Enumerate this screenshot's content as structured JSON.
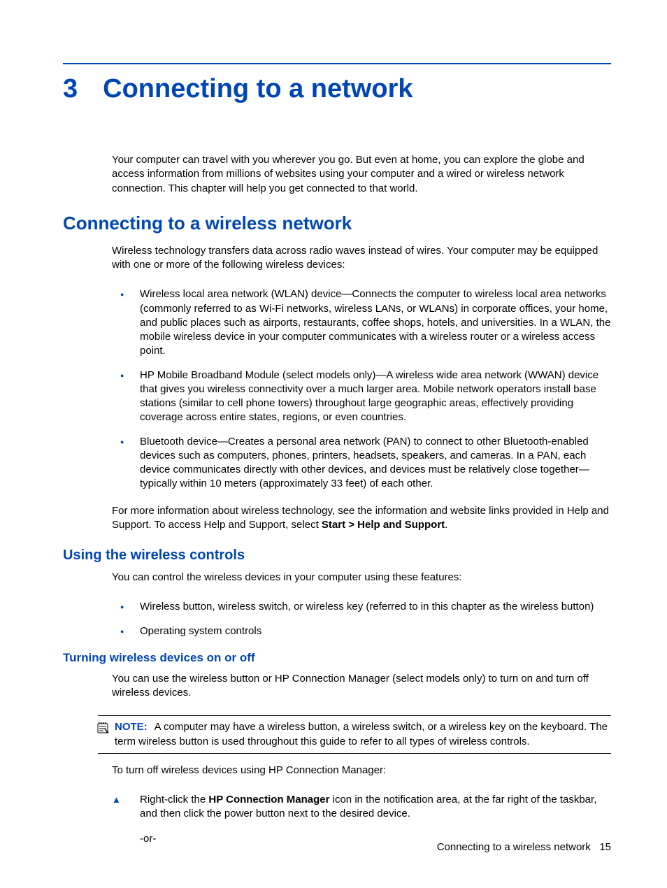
{
  "chapter": {
    "number": "3",
    "title": "Connecting to a network"
  },
  "intro": "Your computer can travel with you wherever you go. But even at home, you can explore the globe and access information from millions of websites using your computer and a wired or wireless network connection. This chapter will help you get connected to that world.",
  "section1": {
    "title": "Connecting to a wireless network",
    "intro": "Wireless technology transfers data across radio waves instead of wires. Your computer may be equipped with one or more of the following wireless devices:",
    "bullets": [
      "Wireless local area network (WLAN) device—Connects the computer to wireless local area networks (commonly referred to as Wi-Fi networks, wireless LANs, or WLANs) in corporate offices, your home, and public places such as airports, restaurants, coffee shops, hotels, and universities. In a WLAN, the mobile wireless device in your computer communicates with a wireless router or a wireless access point.",
      "HP Mobile Broadband Module (select models only)—A wireless wide area network (WWAN) device that gives you wireless connectivity over a much larger area. Mobile network operators install base stations (similar to cell phone towers) throughout large geographic areas, effectively providing coverage across entire states, regions, or even countries.",
      "Bluetooth device—Creates a personal area network (PAN) to connect to other Bluetooth-enabled devices such as computers, phones, printers, headsets, speakers, and cameras. In a PAN, each device communicates directly with other devices, and devices must be relatively close together—typically within 10 meters (approximately 33 feet) of each other."
    ],
    "after_pre": "For more information about wireless technology, see the information and website links provided in Help and Support. To access Help and Support, select ",
    "after_bold": "Start > Help and Support",
    "after_post": "."
  },
  "section2": {
    "title": "Using the wireless controls",
    "intro": "You can control the wireless devices in your computer using these features:",
    "bullets": [
      "Wireless button, wireless switch, or wireless key (referred to in this chapter as the wireless button)",
      "Operating system controls"
    ]
  },
  "section3": {
    "title": "Turning wireless devices on or off",
    "intro": "You can use the wireless button or HP Connection Manager (select models only) to turn on and turn off wireless devices.",
    "note_label": "NOTE:",
    "note_text": "A computer may have a wireless button, a wireless switch, or a wireless key on the keyboard. The term wireless button is used throughout this guide to refer to all types of wireless controls.",
    "after_note": "To turn off wireless devices using HP Connection Manager:",
    "step_pre": "Right-click the ",
    "step_bold": "HP Connection Manager",
    "step_post": " icon in the notification area, at the far right of the taskbar, and then click the power button next to the desired device.",
    "or": "-or-"
  },
  "footer": {
    "text": "Connecting to a wireless network",
    "page": "15"
  }
}
